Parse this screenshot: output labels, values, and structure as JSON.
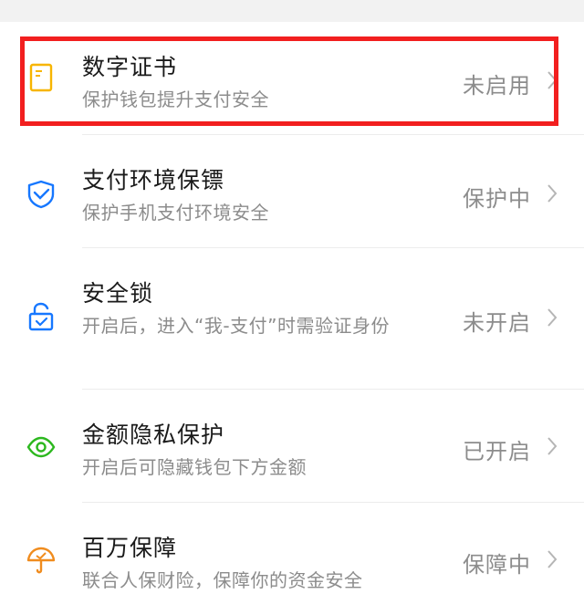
{
  "accent_colors": {
    "blue": "#1677ff",
    "yellow": "#f7b500",
    "green": "#2db81f",
    "orange": "#f08c1e",
    "highlight": "#f21f1f"
  },
  "items": [
    {
      "icon": "certificate-icon",
      "title": "数字证书",
      "subtitle": "保护钱包提升支付安全",
      "status": "未启用"
    },
    {
      "icon": "shield-check-icon",
      "title": "支付环境保镖",
      "subtitle": "保护手机支付环境安全",
      "status": "保护中"
    },
    {
      "icon": "lock-icon",
      "title": "安全锁",
      "subtitle": "开启后，进入“我-支付”时需验证身份",
      "status": "未开启"
    },
    {
      "icon": "eye-icon",
      "title": "金额隐私保护",
      "subtitle": "开启后可隐藏钱包下方金额",
      "status": "已开启"
    },
    {
      "icon": "umbrella-icon",
      "title": "百万保障",
      "subtitle": "联合人保财险，保障你的资金安全",
      "status": "保障中"
    }
  ]
}
